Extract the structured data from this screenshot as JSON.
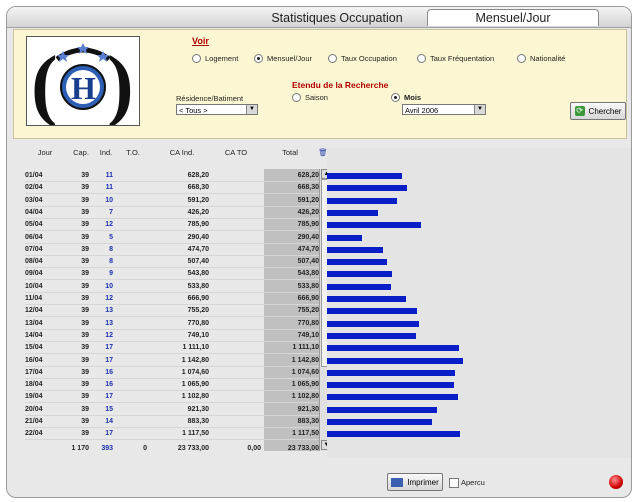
{
  "tabs": {
    "active": "Statistiques Occupation",
    "inactive": "Mensuel/Jour"
  },
  "filters": {
    "voir_label": "Voir",
    "options": [
      "Logement",
      "Mensuel/Jour",
      "Taux Occupation",
      "Taux Fréquentation",
      "Nationalité"
    ],
    "selected": "Mensuel/Jour",
    "residence_label": "Résidence/Batiment",
    "residence_value": "< Tous >",
    "etendu_label": "Etendu de la Recherche",
    "scope_options": [
      "Saison",
      "Mois"
    ],
    "scope_selected": "Mois",
    "month_value": "Avril 2006",
    "search_button": "Chercher"
  },
  "table": {
    "headers": [
      "Jour",
      "Cap.",
      "Ind.",
      "T.O.",
      "CA Ind.",
      "CA TO",
      "Total"
    ],
    "rows": [
      [
        "01/04",
        "39",
        "11",
        "",
        "628,20",
        "",
        "628,20"
      ],
      [
        "02/04",
        "39",
        "11",
        "",
        "668,30",
        "",
        "668,30"
      ],
      [
        "03/04",
        "39",
        "10",
        "",
        "591,20",
        "",
        "591,20"
      ],
      [
        "04/04",
        "39",
        "7",
        "",
        "426,20",
        "",
        "426,20"
      ],
      [
        "05/04",
        "39",
        "12",
        "",
        "785,90",
        "",
        "785,90"
      ],
      [
        "06/04",
        "39",
        "5",
        "",
        "290,40",
        "",
        "290,40"
      ],
      [
        "07/04",
        "39",
        "8",
        "",
        "474,70",
        "",
        "474,70"
      ],
      [
        "08/04",
        "39",
        "8",
        "",
        "507,40",
        "",
        "507,40"
      ],
      [
        "09/04",
        "39",
        "9",
        "",
        "543,80",
        "",
        "543,80"
      ],
      [
        "10/04",
        "39",
        "10",
        "",
        "533,80",
        "",
        "533,80"
      ],
      [
        "11/04",
        "39",
        "12",
        "",
        "666,90",
        "",
        "666,90"
      ],
      [
        "12/04",
        "39",
        "13",
        "",
        "755,20",
        "",
        "755,20"
      ],
      [
        "13/04",
        "39",
        "13",
        "",
        "770,80",
        "",
        "770,80"
      ],
      [
        "14/04",
        "39",
        "12",
        "",
        "749,10",
        "",
        "749,10"
      ],
      [
        "15/04",
        "39",
        "17",
        "",
        "1 111,10",
        "",
        "1 111,10"
      ],
      [
        "16/04",
        "39",
        "17",
        "",
        "1 142,80",
        "",
        "1 142,80"
      ],
      [
        "17/04",
        "39",
        "16",
        "",
        "1 074,60",
        "",
        "1 074,60"
      ],
      [
        "18/04",
        "39",
        "16",
        "",
        "1 065,90",
        "",
        "1 065,90"
      ],
      [
        "19/04",
        "39",
        "17",
        "",
        "1 102,80",
        "",
        "1 102,80"
      ],
      [
        "20/04",
        "39",
        "15",
        "",
        "921,30",
        "",
        "921,30"
      ],
      [
        "21/04",
        "39",
        "14",
        "",
        "883,30",
        "",
        "883,30"
      ],
      [
        "22/04",
        "39",
        "17",
        "",
        "1 117,50",
        "",
        "1 117,50"
      ]
    ],
    "totals": [
      "",
      "1 170",
      "393",
      "0",
      "23 733,00",
      "0,00",
      "23 733,00"
    ]
  },
  "chart_values": [
    628.2,
    668.3,
    591.2,
    426.2,
    785.9,
    290.4,
    474.7,
    507.4,
    543.8,
    533.8,
    666.9,
    755.2,
    770.8,
    749.1,
    1111.1,
    1142.8,
    1074.6,
    1065.9,
    1102.8,
    921.3,
    883.3,
    1117.5
  ],
  "chart_max": 1142.8,
  "footer": {
    "print_button": "Imprimer",
    "preview_label": "Apercu"
  }
}
